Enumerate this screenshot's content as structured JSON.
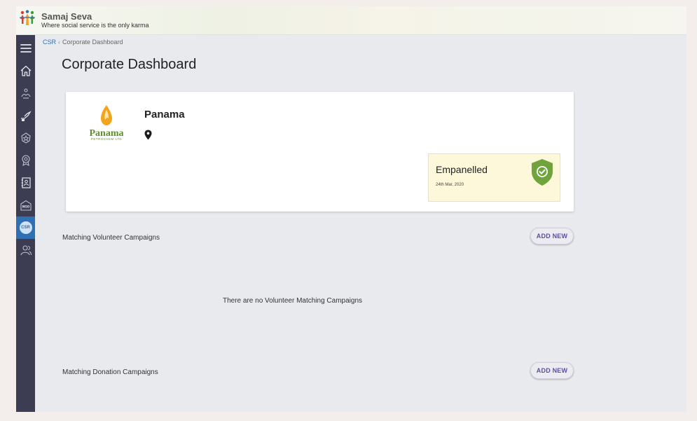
{
  "header": {
    "app_name": "Samaj Seva",
    "tagline": "Where social service is the only karma"
  },
  "sidebar": {
    "items": [
      {
        "icon": "hamburger-menu-icon",
        "active": false
      },
      {
        "icon": "home-icon",
        "active": false
      },
      {
        "icon": "charity-hands-icon",
        "active": false
      },
      {
        "icon": "donate-hand-icon",
        "active": false
      },
      {
        "icon": "badge-icon",
        "active": false
      },
      {
        "icon": "award-icon",
        "active": false
      },
      {
        "icon": "contacts-book-icon",
        "active": false
      },
      {
        "icon": "ngo-building-icon",
        "label": "NGO",
        "active": false
      },
      {
        "icon": "csr-icon",
        "label": "CSR",
        "active": true
      },
      {
        "icon": "users-icon",
        "active": false
      }
    ]
  },
  "breadcrumb": {
    "root": "CSR",
    "separator": "‹",
    "current": "Corporate Dashboard"
  },
  "page_title": "Corporate Dashboard",
  "company": {
    "name": "Panama",
    "logo_text": "Panama",
    "logo_subtext": "PETROCHEM LTD"
  },
  "status": {
    "label": "Empanelled",
    "date": "24th Mar, 2020"
  },
  "volunteer_section": {
    "title": "Matching Volunteer Campaigns",
    "add_label": "ADD NEW",
    "empty_message": "There are no Volunteer Matching Campaigns"
  },
  "donation_section": {
    "title": "Matching Donation Campaigns",
    "add_label": "ADD NEW"
  },
  "colors": {
    "sidebar": "#3c3c52",
    "active": "#2f6fb4",
    "shield": "#6fa33c",
    "button_text": "#5a4fa0"
  }
}
